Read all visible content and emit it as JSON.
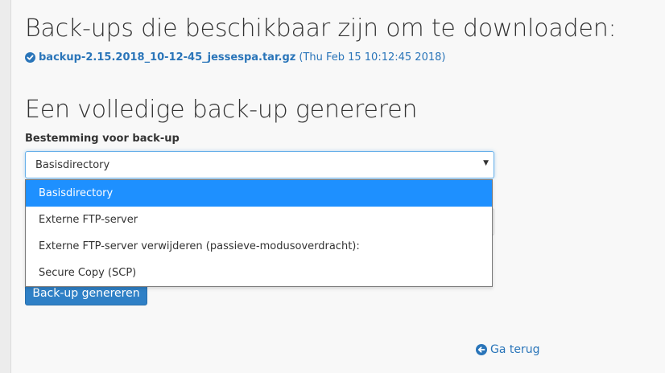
{
  "downloads": {
    "heading": "Back-ups die beschikbaar zijn om te downloaden:",
    "backup_file": "backup-2.15.2018_10-12-45_jessespa.tar.gz",
    "backup_date": "(Thu Feb 15 10:12:45 2018)"
  },
  "generate": {
    "heading": "Een volledige back-up genereren",
    "destination_label": "Bestemming voor back-up",
    "destination_selected": "Basisdirectory",
    "options": [
      "Basisdirectory",
      "Externe FTP-server",
      "Externe FTP-server verwijderen (passieve-modusoverdracht):",
      "Secure Copy (SCP)"
    ],
    "button_label": "Back-up genereren"
  },
  "footer": {
    "back_label": "Ga terug"
  },
  "colors": {
    "link": "#2a75b9",
    "primary_button": "#2f80c6",
    "selected_option": "#1e90ff"
  },
  "icons": {
    "backup_status": "check-circle-icon",
    "back": "arrow-circle-left-icon",
    "select": "caret-down-icon"
  }
}
